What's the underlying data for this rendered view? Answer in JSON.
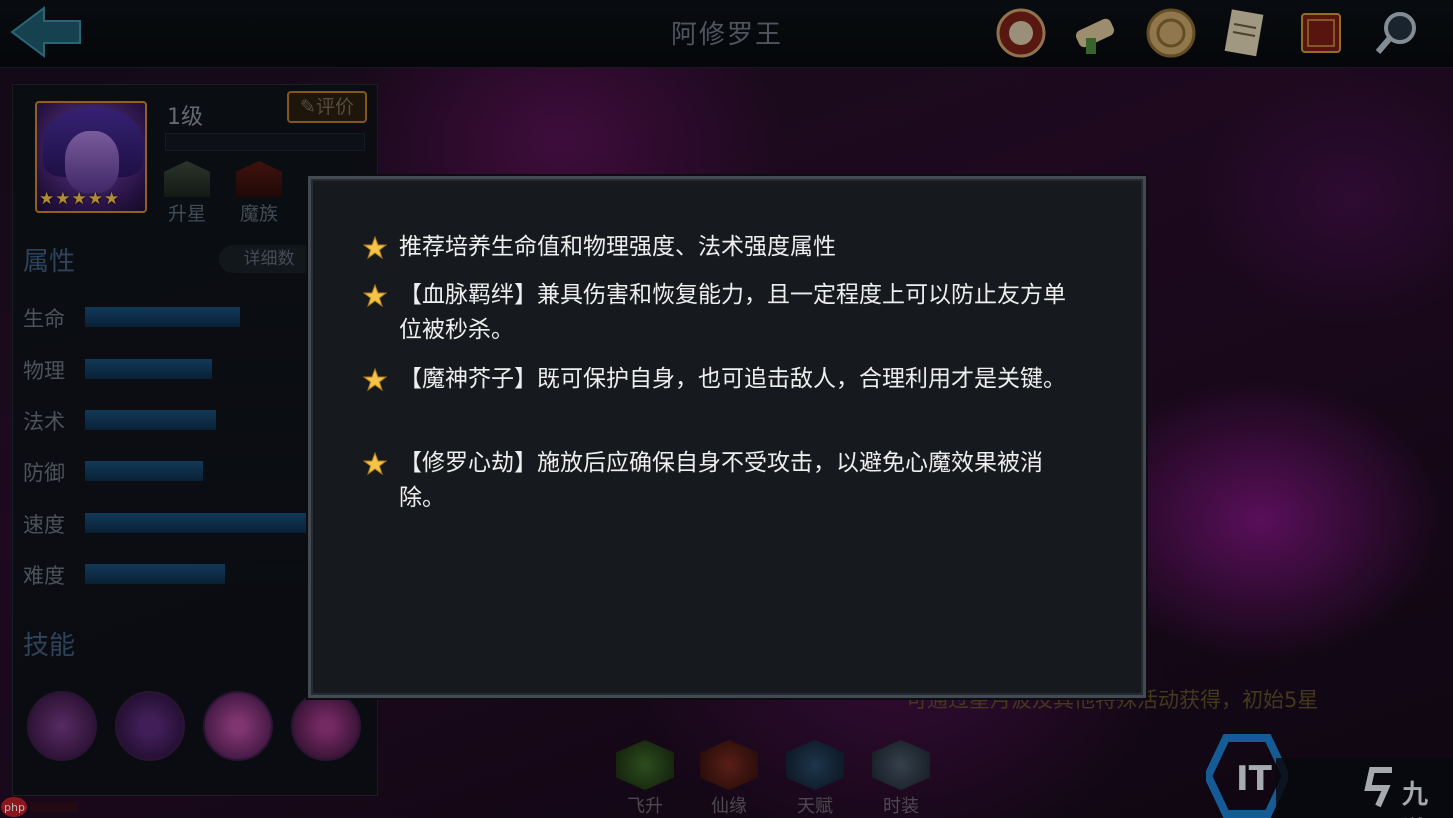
{
  "header": {
    "title": "阿修罗王"
  },
  "hero": {
    "level": "1级",
    "review_label": "评价",
    "star_count": 5,
    "badges": [
      "升星",
      "魔族"
    ]
  },
  "attributes": {
    "title": "属性",
    "detail_label": "详细数",
    "rows": [
      {
        "label": "生命",
        "value": 0.7
      },
      {
        "label": "物理",
        "value": 0.57
      },
      {
        "label": "法术",
        "value": 0.59
      },
      {
        "label": "防御",
        "value": 0.53
      },
      {
        "label": "速度",
        "value": 1.0
      },
      {
        "label": "难度",
        "value": 0.63
      }
    ]
  },
  "skills": {
    "title": "技能"
  },
  "hint": "可通过星月波及其他特殊活动获得，初始5星",
  "bottom_tabs": [
    "飞升",
    "仙缘",
    "天赋",
    "时装"
  ],
  "modal": {
    "tips": [
      "推荐培养生命值和物理强度、法术强度属性",
      "【血脉羁绊】兼具伤害和恢复能力，且一定程度上可以防止友方单位被秒杀。",
      "【魔神芥子】既可保护自身，也可追击敌人，合理利用才是关键。",
      "【修罗心劫】施放后应确保自身不受攻击，以避免心魔效果被消除。"
    ]
  },
  "watermarks": {
    "php": "php",
    "site": "九游",
    "it": "IT"
  },
  "colors": {
    "accent_gold": "#f3c448",
    "bar_blue": "#1a4f7a",
    "modal_bg": "#16191d"
  }
}
